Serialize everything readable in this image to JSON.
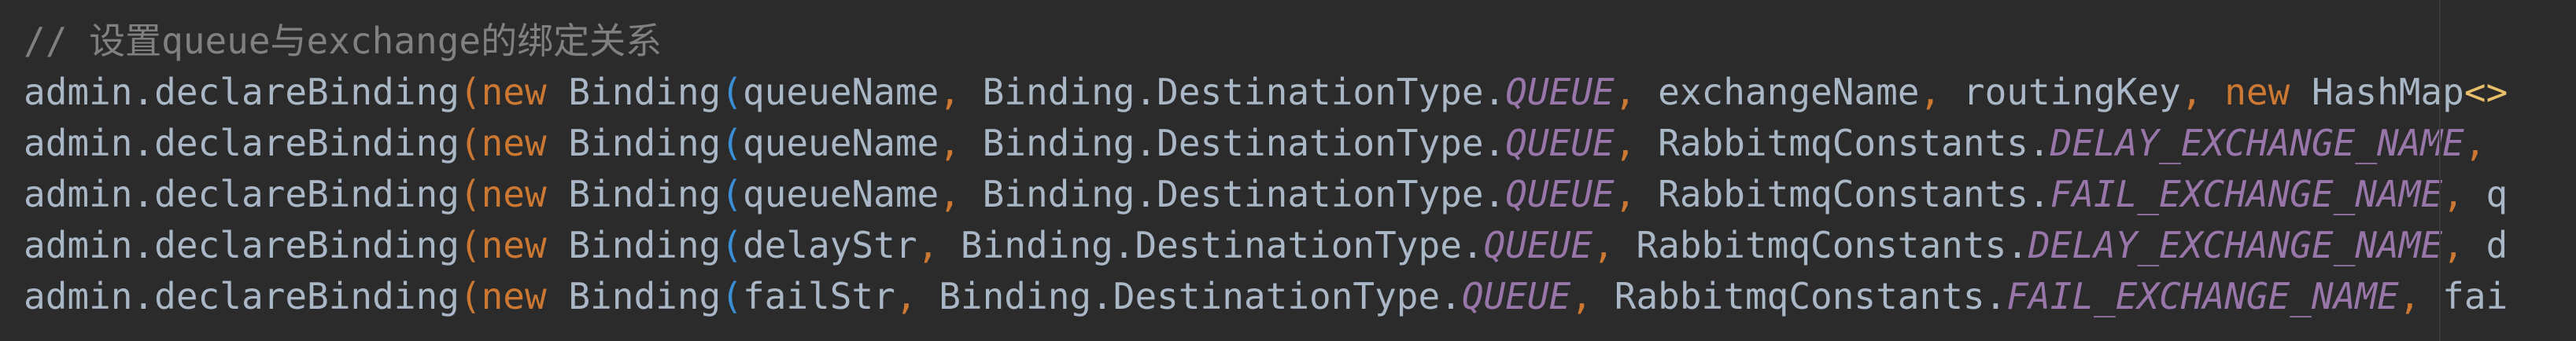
{
  "editor": {
    "comment": "// 设置queue与exchange的绑定关系",
    "lines": [
      {
        "obj": "admin.declareBinding",
        "p1": "(",
        "kw": "new",
        "cls": " Binding",
        "p2": "(",
        "arg1": "queueName",
        "c1": ",",
        "dest": " Binding.DestinationType.",
        "queue": "QUEUE",
        "c2": ",",
        "arg2a": " exchangeName",
        "arg2b": "",
        "c3": ",",
        "arg3": " routingKey",
        "c4": ",",
        "tail_kw": " new",
        "tail": " HashMap",
        "tail_generic": "<>"
      },
      {
        "obj": "admin.declareBinding",
        "p1": "(",
        "kw": "new",
        "cls": " Binding",
        "p2": "(",
        "arg1": "queueName",
        "c1": ",",
        "dest": " Binding.DestinationType.",
        "queue": "QUEUE",
        "c2": ",",
        "arg2a": " RabbitmqConstants.",
        "arg2b": "DELAY_EXCHANGE_NAME",
        "c3": ",",
        "arg3": "",
        "c4": "",
        "tail_kw": "",
        "tail": "",
        "tail_generic": ""
      },
      {
        "obj": "admin.declareBinding",
        "p1": "(",
        "kw": "new",
        "cls": " Binding",
        "p2": "(",
        "arg1": "queueName",
        "c1": ",",
        "dest": " Binding.DestinationType.",
        "queue": "QUEUE",
        "c2": ",",
        "arg2a": " RabbitmqConstants.",
        "arg2b": "FAIL_EXCHANGE_NAME",
        "c3": ",",
        "arg3": " q",
        "c4": "",
        "tail_kw": "",
        "tail": "",
        "tail_generic": ""
      },
      {
        "obj": "admin.declareBinding",
        "p1": "(",
        "kw": "new",
        "cls": " Binding",
        "p2": "(",
        "arg1": "delayStr",
        "c1": ",",
        "dest": " Binding.DestinationType.",
        "queue": "QUEUE",
        "c2": ",",
        "arg2a": " RabbitmqConstants.",
        "arg2b": "DELAY_EXCHANGE_NAME",
        "c3": ",",
        "arg3": " d",
        "c4": "",
        "tail_kw": "",
        "tail": "",
        "tail_generic": ""
      },
      {
        "obj": "admin.declareBinding",
        "p1": "(",
        "kw": "new",
        "cls": " Binding",
        "p2": "(",
        "arg1": "failStr",
        "c1": ",",
        "dest": " Binding.DestinationType.",
        "queue": "QUEUE",
        "c2": ",",
        "arg2a": " RabbitmqConstants.",
        "arg2b": "FAIL_EXCHANGE_NAME",
        "c3": ",",
        "arg3": " fai",
        "c4": "",
        "tail_kw": "",
        "tail": "",
        "tail_generic": ""
      }
    ]
  }
}
